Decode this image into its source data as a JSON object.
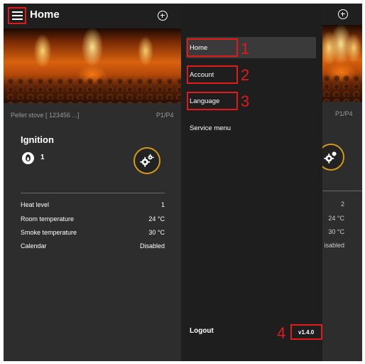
{
  "app": {
    "title": "Home",
    "stove_id": "Pellet stove [ 123456 ...]",
    "page_indicator": "P1/P4"
  },
  "ignition": {
    "title": "Ignition",
    "value": "1"
  },
  "stats": [
    {
      "label": "Heat level",
      "value": "1"
    },
    {
      "label": "Room temperature",
      "value": "24 °C"
    },
    {
      "label": "Smoke temperature",
      "value": "30 °C"
    },
    {
      "label": "Calendar",
      "value": "Disabled"
    }
  ],
  "right_stats": [
    {
      "value": "2"
    },
    {
      "value": "24 °C"
    },
    {
      "value": "30 °C"
    },
    {
      "value": "isabled"
    }
  ],
  "menu": {
    "items": [
      {
        "label": "Home",
        "callout": "1"
      },
      {
        "label": "Account",
        "callout": "2"
      },
      {
        "label": "Language",
        "callout": "3"
      },
      {
        "label": "Service menu"
      }
    ],
    "logout": "Logout",
    "version": "v1.4.0",
    "version_callout": "4"
  },
  "colors": {
    "annotation_red": "#e11a1a",
    "gear_ring": "#d49a18",
    "panel_bg": "#2d2d2d",
    "drawer_bg": "#1e1e1e"
  },
  "icons": {
    "menu": "hamburger-menu-icon",
    "add": "add-circle-icon",
    "ignition": "flame-icon",
    "settings": "gear-icon"
  }
}
